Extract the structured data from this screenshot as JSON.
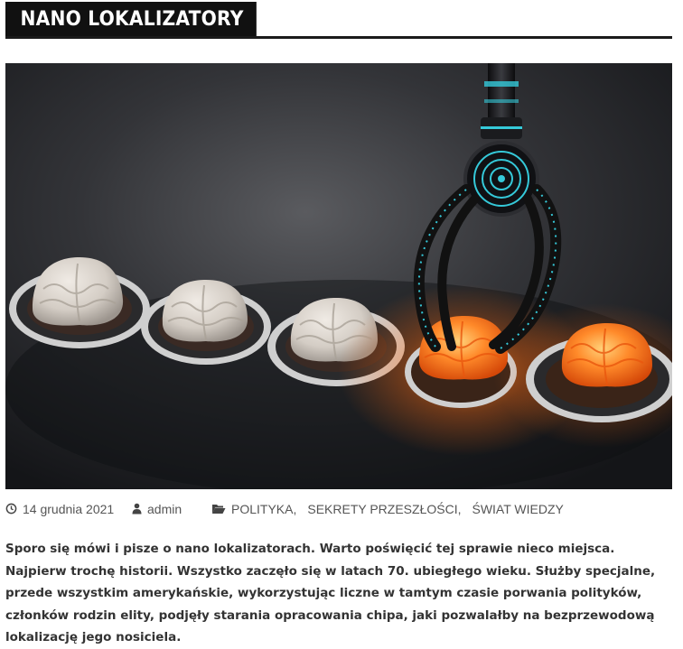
{
  "post": {
    "title": "NANO LOKALIZATORY",
    "date": "14 grudnia 2021",
    "author": "admin",
    "categories": [
      "POLITYKA,",
      "SEKRETY PRZESZŁOŚCI,",
      "ŚWIAT WIEDZY"
    ],
    "excerpt": "Sporo się mówi i pisze o nano lokalizatorach. Warto poświęcić tej sprawie nieco miejsca. Najpierw trochę historii. Wszystko zaczęło się w latach 70. ubiegłego wieku. Służby specjalne, przede wszystkim amerykańskie, wykorzystując liczne w tamtym czasie porwania polityków, członków rodzin elity, podjęły starania opracowania chipa, jaki pozwalałby na bezprzewodową lokalizację jego nosiciela."
  },
  "icons": {
    "date": "clock-icon",
    "author": "user-icon",
    "categories": "folder-open-icon"
  },
  "colors": {
    "title_bg": "#111111",
    "title_text": "#ffffff",
    "brain_grey": "#d8d2cb",
    "brain_glow": "#ff7a1e",
    "claw_accent": "#35c9d9"
  }
}
